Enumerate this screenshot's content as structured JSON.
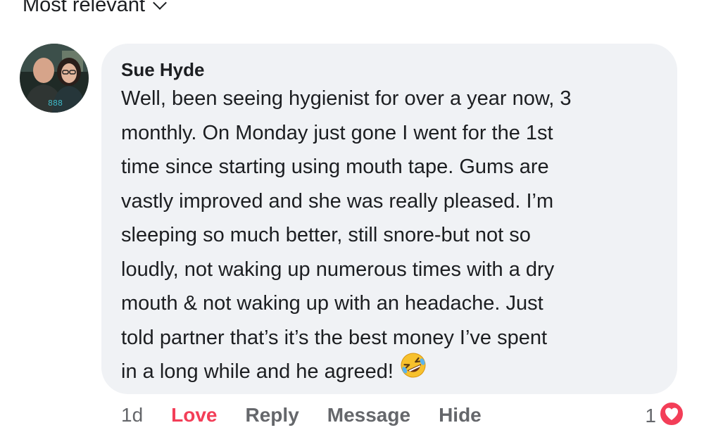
{
  "sort": {
    "label": "Most relevant",
    "icon": "chevron-down-icon"
  },
  "comment": {
    "author": "Sue Hyde",
    "avatar_icon": "profile-photo",
    "lines": [
      "Well, been seeing hygienist for over a year now, 3",
      "monthly. On Monday just gone I went for the 1st",
      "time since starting using mouth tape.  Gums are",
      "vastly improved and she was really pleased. I’m",
      "sleeping so much better, still snore-but not so",
      "loudly, not waking up numerous times with a dry",
      "mouth & not waking up with an headache. Just",
      "told partner that’s it’s the best money I’ve spent",
      "in a long while and he agreed!"
    ],
    "emoji_icon": "rolling-on-floor-laughing-emoji"
  },
  "actions": {
    "time": "1d",
    "love": "Love",
    "reply": "Reply",
    "message": "Message",
    "hide": "Hide"
  },
  "reactions": {
    "count": "1",
    "icon": "heart-reaction-icon"
  },
  "colors": {
    "bubble": "#f0f2f5",
    "love": "#f33e58",
    "muted": "#65676b",
    "text": "#1c1e21"
  }
}
